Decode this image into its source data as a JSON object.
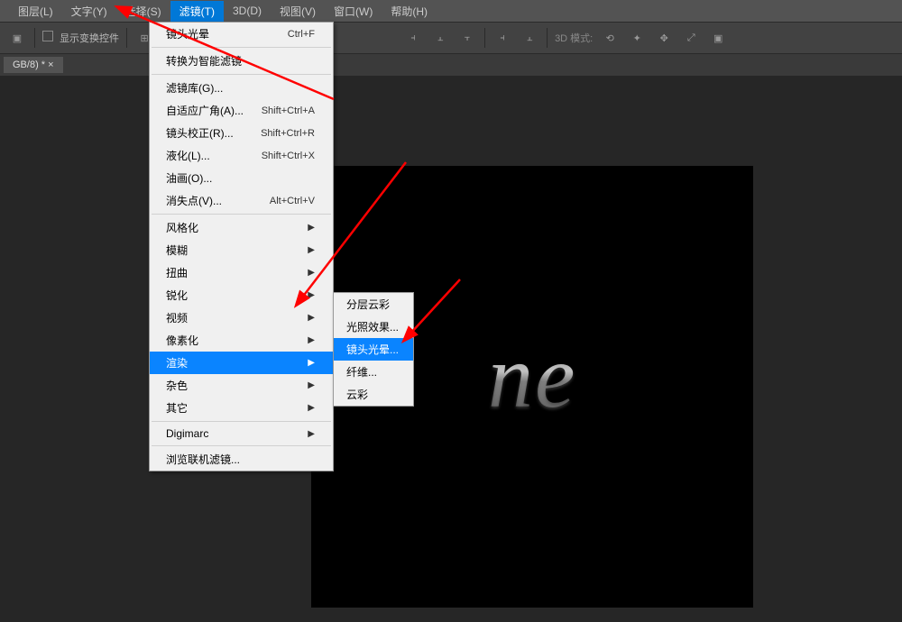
{
  "menubar": {
    "items": [
      "图层(L)",
      "文字(Y)",
      "选择(S)",
      "滤镜(T)",
      "3D(D)",
      "视图(V)",
      "窗口(W)",
      "帮助(H)"
    ],
    "active_index": 3
  },
  "toolbar": {
    "checkbox_label": "显示变换控件",
    "mode3d_label": "3D 模式:"
  },
  "tabbar": {
    "tab_label": "GB/8) * ×"
  },
  "canvas": {
    "text": "ne"
  },
  "dropdown": {
    "last_filter": {
      "label": "镜头光晕",
      "shortcut": "Ctrl+F"
    },
    "convert_smart": "转换为智能滤镜",
    "group2": [
      {
        "label": "滤镜库(G)...",
        "shortcut": ""
      },
      {
        "label": "自适应广角(A)...",
        "shortcut": "Shift+Ctrl+A"
      },
      {
        "label": "镜头校正(R)...",
        "shortcut": "Shift+Ctrl+R"
      },
      {
        "label": "液化(L)...",
        "shortcut": "Shift+Ctrl+X"
      },
      {
        "label": "油画(O)...",
        "shortcut": ""
      },
      {
        "label": "消失点(V)...",
        "shortcut": "Alt+Ctrl+V"
      }
    ],
    "group3": [
      {
        "label": "风格化",
        "has_sub": true
      },
      {
        "label": "模糊",
        "has_sub": true
      },
      {
        "label": "扭曲",
        "has_sub": true
      },
      {
        "label": "锐化",
        "has_sub": true
      },
      {
        "label": "视频",
        "has_sub": true
      },
      {
        "label": "像素化",
        "has_sub": true
      },
      {
        "label": "渲染",
        "has_sub": true,
        "highlight": true
      },
      {
        "label": "杂色",
        "has_sub": true
      },
      {
        "label": "其它",
        "has_sub": true
      }
    ],
    "group4": [
      {
        "label": "Digimarc",
        "has_sub": true
      }
    ],
    "group5": [
      {
        "label": "浏览联机滤镜...",
        "has_sub": false
      }
    ]
  },
  "submenu": {
    "items": [
      {
        "label": "分层云彩",
        "highlight": false
      },
      {
        "label": "光照效果...",
        "highlight": false
      },
      {
        "label": "镜头光晕...",
        "highlight": true
      },
      {
        "label": "纤维...",
        "highlight": false
      },
      {
        "label": "云彩",
        "highlight": false
      }
    ]
  }
}
